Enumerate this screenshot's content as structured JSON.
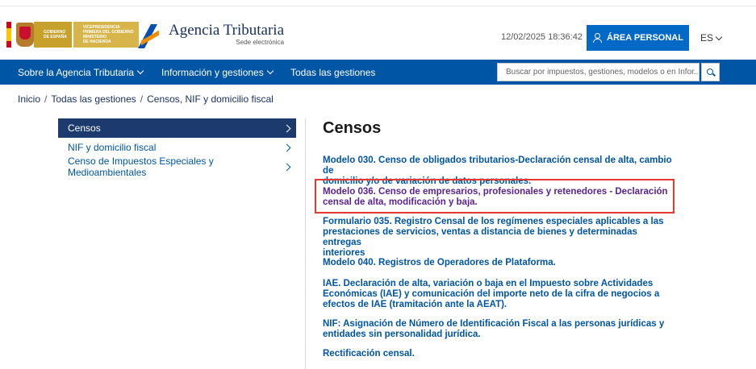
{
  "header": {
    "gov_text_1": [
      "VICEPRESIDENCIA",
      "PRIMERA DEL GOBIERNO"
    ],
    "gov_text_2": [
      "GOBIERNO",
      "DE ESPAÑA"
    ],
    "gov_text_3": [
      "MINISTERIO",
      "DE HACIENDA"
    ],
    "agency_title": "Agencia Tributaria",
    "agency_subtitle": "Sede electrónica",
    "datetime": "12/02/2025 18:36:42",
    "area_button": "ÁREA PERSONAL",
    "language": "ES"
  },
  "nav": {
    "items": [
      {
        "label": "Sobre la Agencia Tributaria",
        "dropdown": true
      },
      {
        "label": "Información y gestiones",
        "dropdown": true
      },
      {
        "label": "Todas las gestiones",
        "dropdown": false
      }
    ],
    "search_placeholder": "Buscar por impuestos, gestiones, modelos o en Infor..."
  },
  "breadcrumb": [
    "Inicio",
    "Todas las gestiones",
    "Censos, NIF y domicilio fiscal"
  ],
  "sidebar": {
    "items": [
      {
        "label": "Censos",
        "active": true
      },
      {
        "label": "NIF y domicilio fiscal",
        "active": false
      },
      {
        "label": "Censo de Impuestos Especiales y Medioambientales",
        "active": false
      }
    ]
  },
  "main": {
    "title": "Censos",
    "links": [
      {
        "lines": [
          "Modelo 030. Censo de obligados tributarios-Declaración censal de alta, cambio de",
          "domicilio y/o de variación de datos personales."
        ],
        "visited": false
      },
      {
        "lines": [
          "Modelo 036. Censo de empresarios, profesionales y retenedores - Declaración",
          "censal de alta, modificación y baja."
        ],
        "visited": true
      },
      {
        "lines": [
          "Formulario 035. Registro Censal de los regímenes especiales aplicables a las",
          "prestaciones de servicios, ventas a distancia de bienes y determinadas entregas",
          "interiores"
        ],
        "visited": false
      },
      {
        "lines": [
          "Modelo 040. Registros de Operadores de Plataforma."
        ],
        "visited": false
      },
      {
        "lines": [
          "IAE. Declaración de alta, variación o baja en el Impuesto sobre Actividades",
          "Económicas (IAE) y comunicación del importe neto de la cifra de negocios a",
          "efectos de IAE (tramitación ante la AEAT)."
        ],
        "visited": false
      },
      {
        "lines": [
          "NIF: Asignación de Número de Identificación Fiscal a las personas jurídicas y",
          "entidades sin personalidad jurídica."
        ],
        "visited": false
      },
      {
        "lines": [
          "Rectificación censal."
        ],
        "visited": false
      }
    ]
  },
  "colors": {
    "nav_bg": "#0055a5",
    "sidebar_active_bg": "#1d3a6e",
    "link": "#0055a5",
    "link_visited": "#5b2390",
    "highlight_border": "#e53935",
    "button_bg": "#0069c6"
  }
}
